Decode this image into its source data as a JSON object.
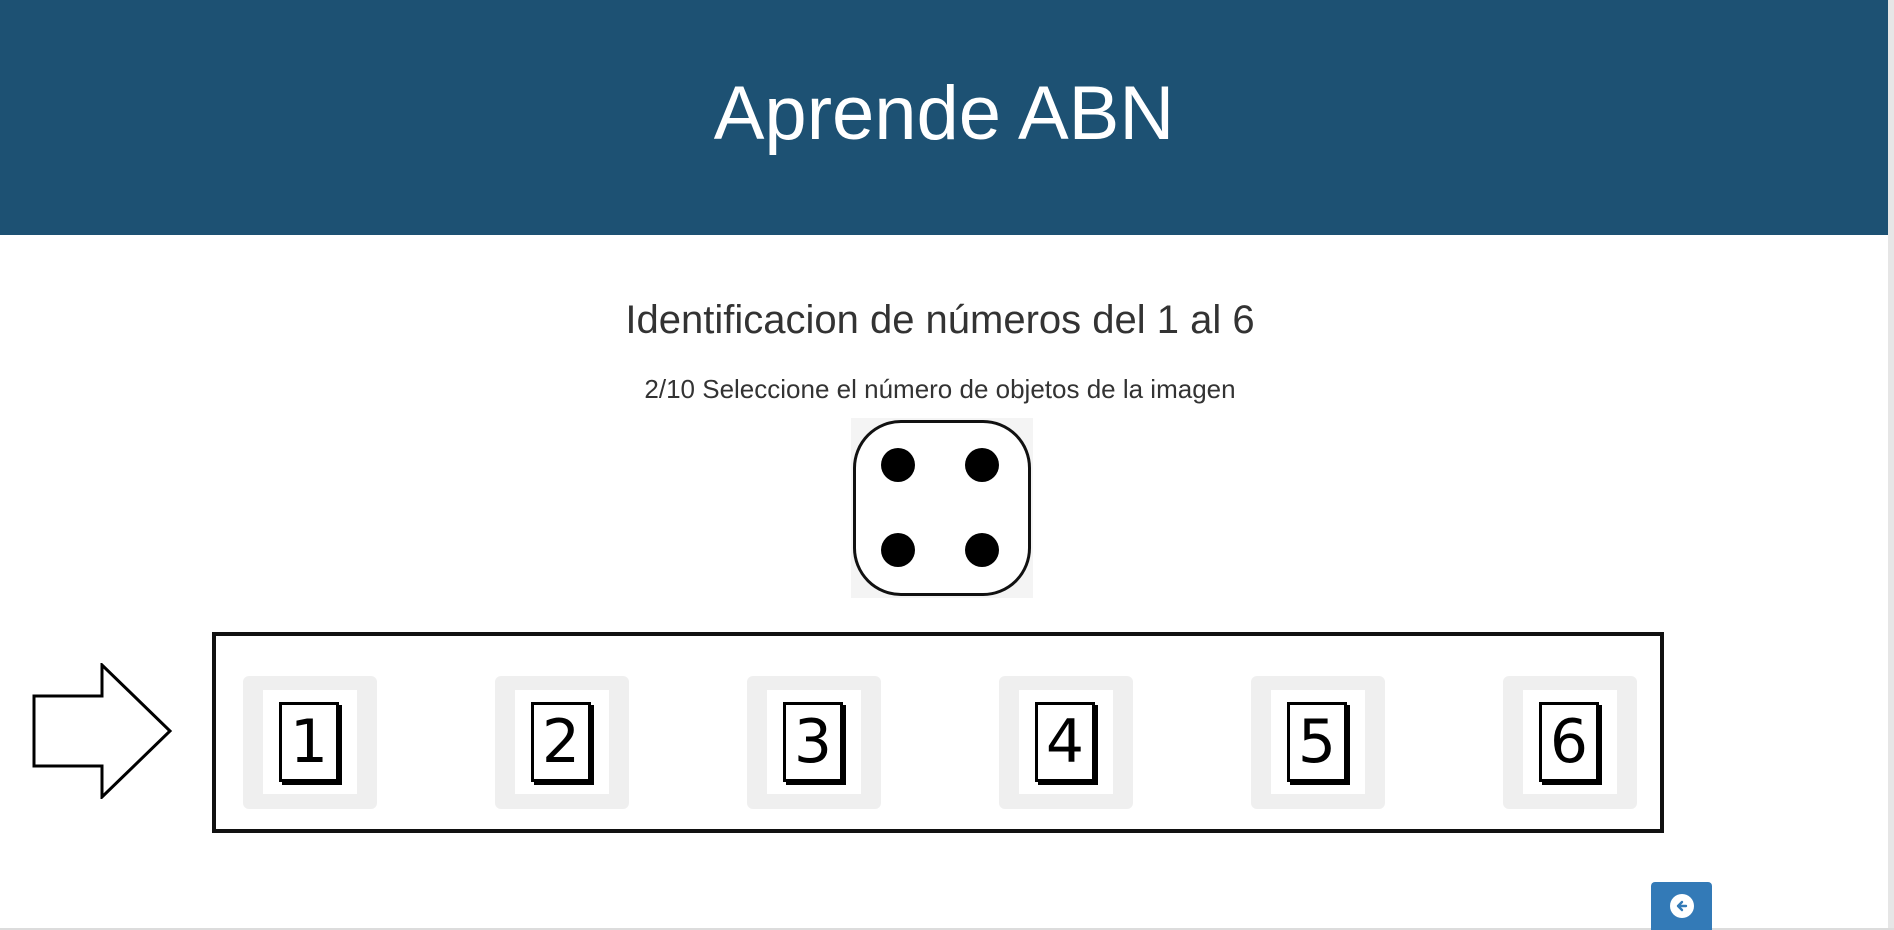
{
  "header": {
    "title": "Aprende ABN"
  },
  "exercise": {
    "title": "Identificacion de números del 1 al 6",
    "prompt": "2/10 Seleccione el número de objetos de la imagen",
    "dice_pips": 4
  },
  "options": [
    {
      "label": "1"
    },
    {
      "label": "2"
    },
    {
      "label": "3"
    },
    {
      "label": "4"
    },
    {
      "label": "5"
    },
    {
      "label": "6"
    }
  ],
  "icons": {
    "pointer": "arrow-right-outline-icon",
    "back": "arrow-circle-left-icon"
  },
  "colors": {
    "header_bg": "#1d5173",
    "button_bg": "#337ab7"
  }
}
